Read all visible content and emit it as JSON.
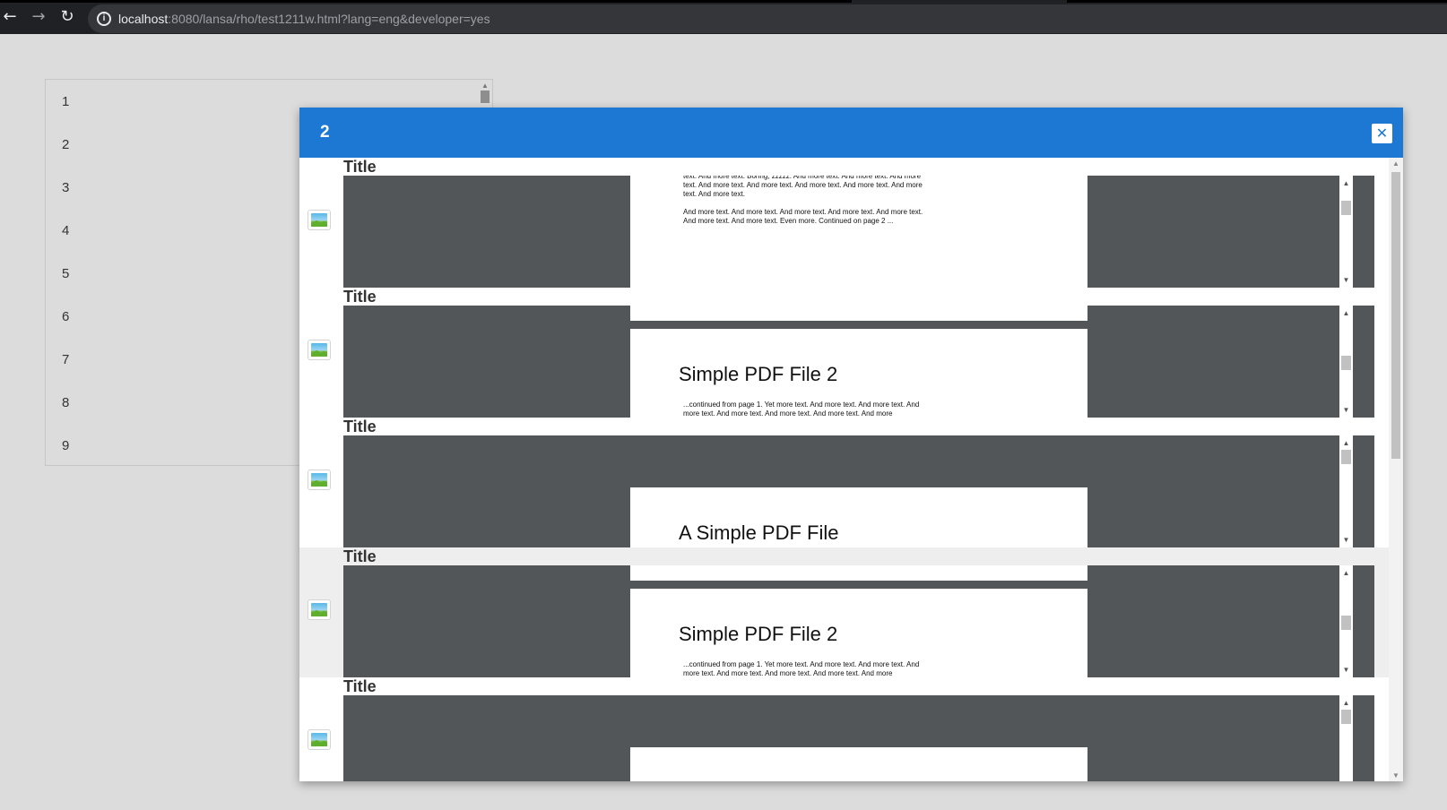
{
  "browser": {
    "url_host": "localhost",
    "url_path": ":8080/lansa/rho/test1211w.html?lang=eng&developer=yes"
  },
  "background_list": {
    "items": [
      "1",
      "2",
      "3",
      "4",
      "5",
      "6",
      "7",
      "8",
      "9"
    ]
  },
  "dialog": {
    "title": "2",
    "close_icon": "close-icon",
    "rows": [
      {
        "title": "Title",
        "icon": "image-icon",
        "page_text_1": "text. And more text. Boring, zzzzz. And more text. And more text. And more text. And more text. And more text. And more text. And more text. And more text. And more text.",
        "page_text_2": "And more text. And more text. And more text. And more text. And more text. And more text. And more text. Even more. Continued on page 2 ..."
      },
      {
        "title": "Title",
        "icon": "image-icon",
        "heading": "Simple PDF File 2",
        "page_text_1": "...continued from page 1. Yet more text. And more text. And more text. And more text. And more text. And more text. And more text. And more"
      },
      {
        "title": "Title",
        "icon": "image-icon",
        "heading": "A Simple PDF File"
      },
      {
        "title": "Title",
        "icon": "image-icon",
        "heading": "Simple PDF File 2",
        "page_text_1": "...continued from page 1. Yet more text. And more text. And more text. And more text. And more text. And more text. And more text. And more"
      },
      {
        "title": "Title",
        "icon": "image-icon"
      }
    ]
  },
  "colors": {
    "header": "#1c78d3",
    "viewer_bg": "#525659",
    "page_bg": "#ffffff",
    "body_bg": "#dcdcdc"
  }
}
